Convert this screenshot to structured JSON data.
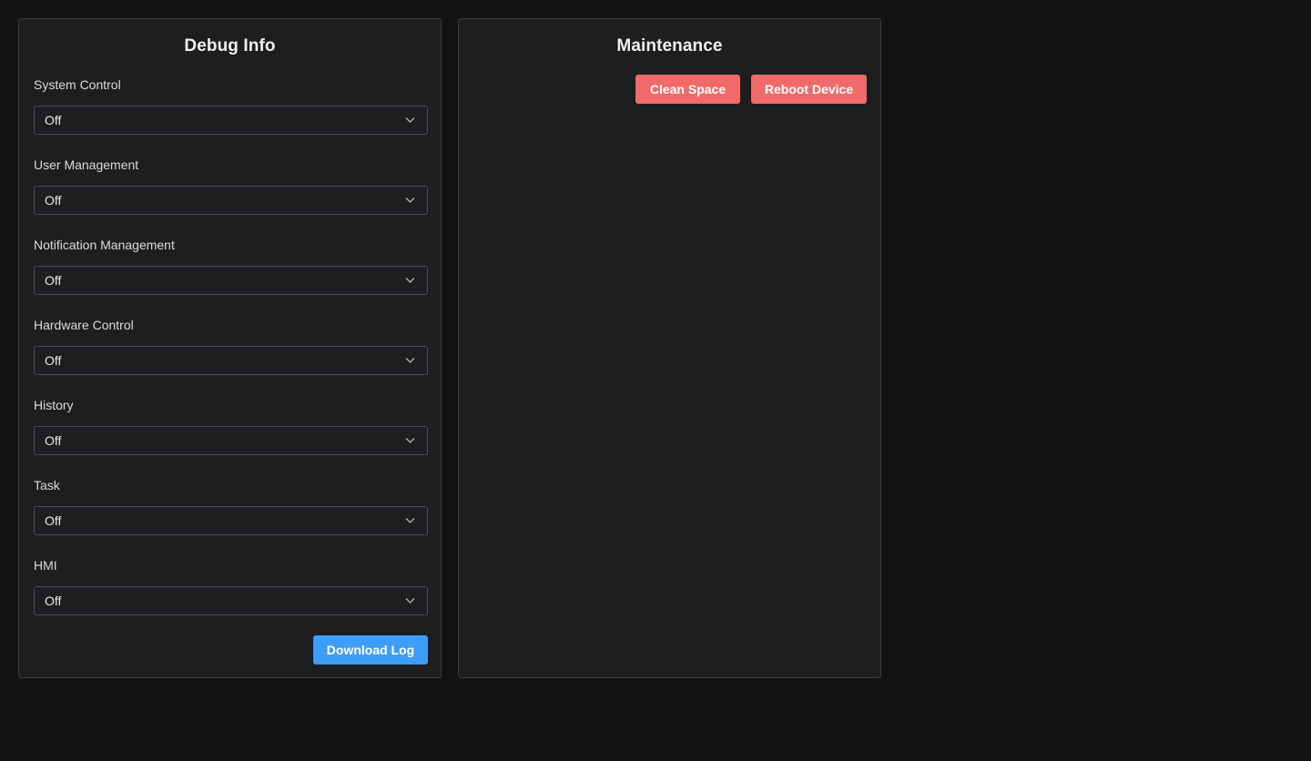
{
  "debug": {
    "title": "Debug Info",
    "fields": [
      {
        "label": "System Control",
        "value": "Off"
      },
      {
        "label": "User Management",
        "value": "Off"
      },
      {
        "label": "Notification Management",
        "value": "Off"
      },
      {
        "label": "Hardware Control",
        "value": "Off"
      },
      {
        "label": "History",
        "value": "Off"
      },
      {
        "label": "Task",
        "value": "Off"
      },
      {
        "label": "HMI",
        "value": "Off"
      }
    ],
    "download_label": "Download Log"
  },
  "maintenance": {
    "title": "Maintenance",
    "clean_label": "Clean Space",
    "reboot_label": "Reboot Device"
  },
  "icons": {
    "select_chevron": "chevron-down-icon"
  },
  "colors": {
    "primary_button": "#3d9ef5",
    "danger_button": "#f06a6a",
    "panel_background": "#1d1e20",
    "page_background": "#121212"
  }
}
